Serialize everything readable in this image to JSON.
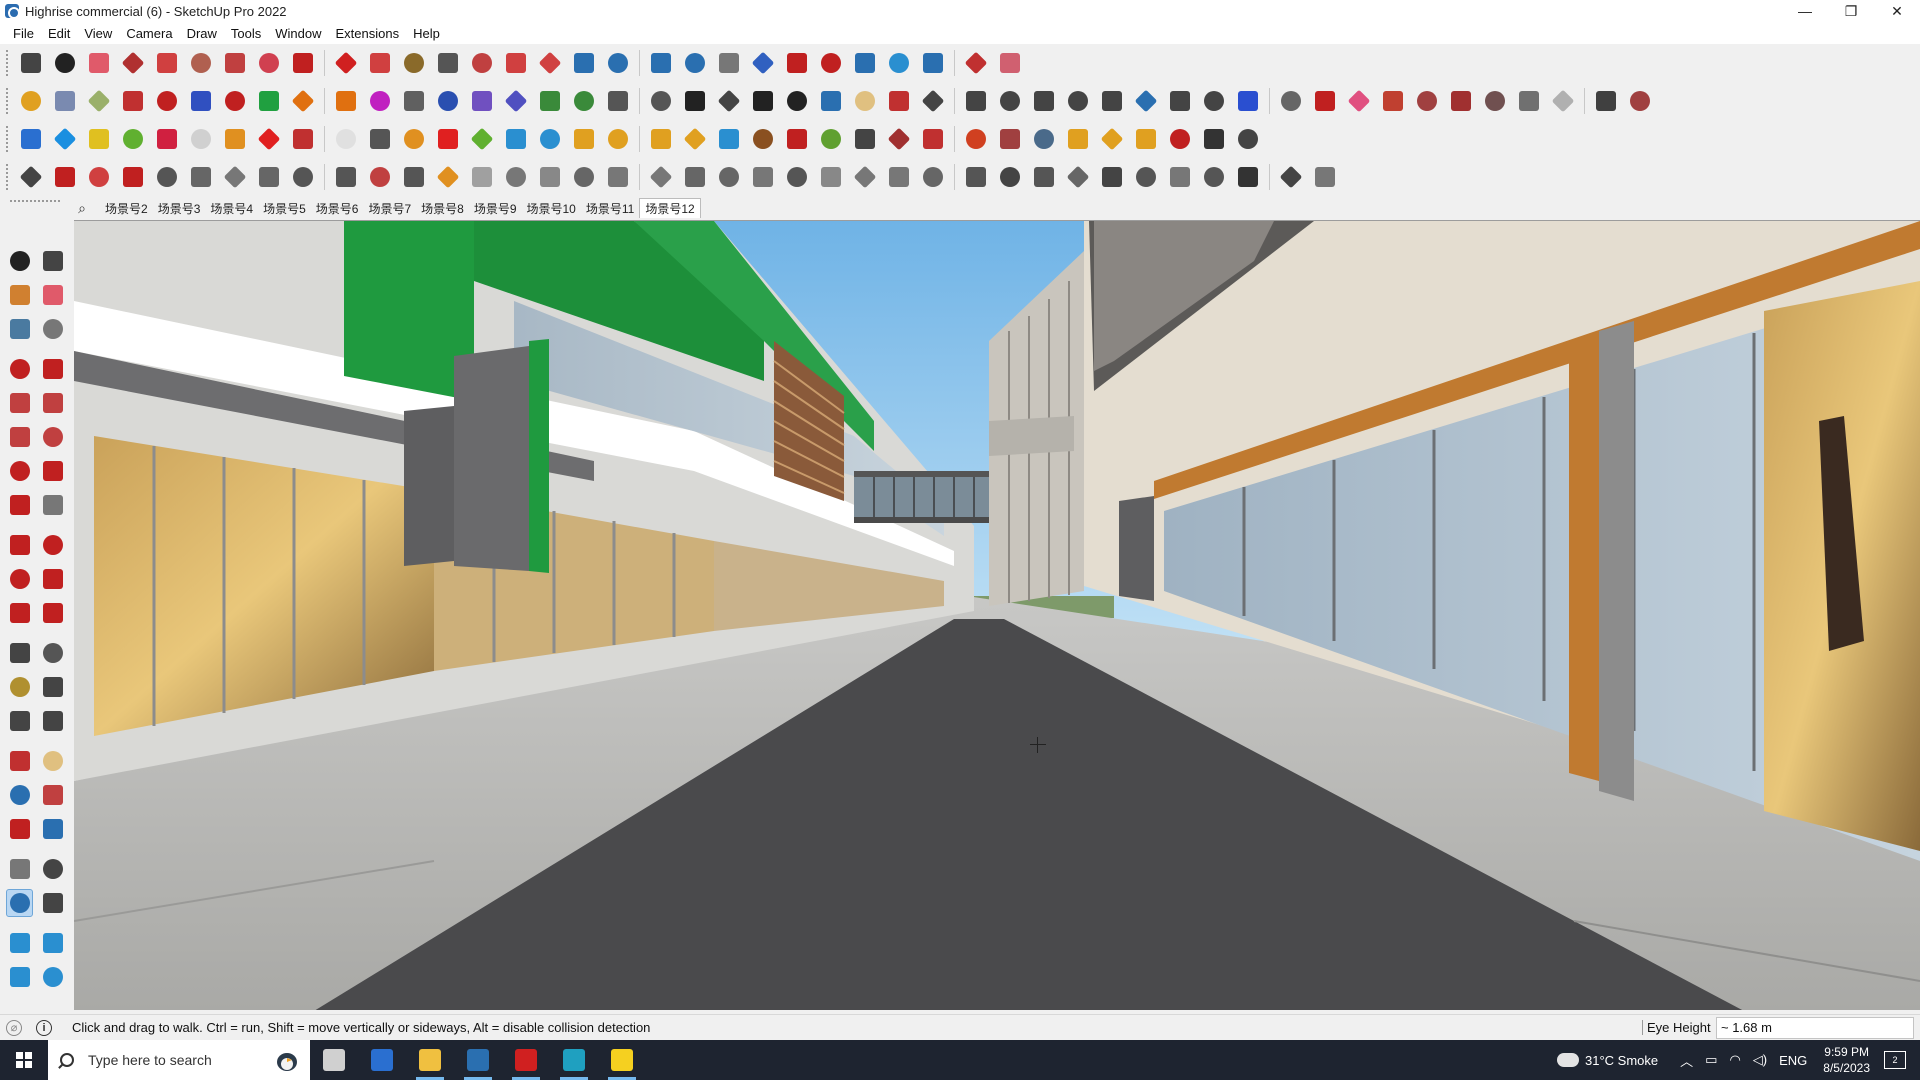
{
  "window": {
    "title": "Highrise commercial (6) - SketchUp Pro 2022",
    "minimize": "—",
    "maximize": "❐",
    "close": "✕"
  },
  "menu": [
    "File",
    "Edit",
    "View",
    "Camera",
    "Draw",
    "Tools",
    "Window",
    "Extensions",
    "Help"
  ],
  "toolbar_colors": {
    "row1": [
      "#444444",
      "#222222",
      "#e05a6a",
      "#b03030",
      "#d04040",
      "#b06050",
      "#c04040",
      "#d04050",
      "#c02020",
      "#d02020",
      "#d04040",
      "#8a6a2a",
      "#555555",
      "#c04040",
      "#d04040",
      "#d04040",
      "#2a6fb0",
      "#2a6fb0",
      "#2a6fb0",
      "#2a6fb0",
      "#777777",
      "#3060c0",
      "#c02020",
      "#c02020",
      "#2a6fb0",
      "#2a8fd0",
      "#2a6fb0",
      "#c03030",
      "#d06070"
    ],
    "row2": [
      "#e0a020",
      "#7a8ab0",
      "#9ab06a",
      "#c03030",
      "#c02020",
      "#3050c0",
      "#c02020",
      "#20a040",
      "#e07010",
      "#e07010",
      "#c020c0",
      "#606060",
      "#2a4fb0",
      "#7050c0",
      "#5050c0",
      "#3a8a3a",
      "#3a8a3a",
      "#555555",
      "#555555",
      "#222222",
      "#444444",
      "#222222",
      "#222222",
      "#2a6fb0",
      "#e0c080",
      "#c03030",
      "#444444",
      "#444444",
      "#444444",
      "#444444",
      "#444444",
      "#444444",
      "#2a6fb0",
      "#444444",
      "#444444",
      "#2a4fd0",
      "#666666",
      "#c02020",
      "#e05080",
      "#c04030",
      "#a04040",
      "#a03030",
      "#705050",
      "#707070",
      "#b0b0b0",
      "#404040",
      "#a04040"
    ],
    "row3": [
      "#2a6fd0",
      "#1a8fe0",
      "#e0c020",
      "#60b030",
      "#d02040",
      "#d0d0d0",
      "#e09020",
      "#e02020",
      "#c03030",
      "#e0e0e0",
      "#555555",
      "#e09020",
      "#e02020",
      "#60b030",
      "#2a8fd0",
      "#2a8fd0",
      "#e0a020",
      "#e0a020",
      "#e0a020",
      "#e0a020",
      "#2a8fd0",
      "#8a5020",
      "#c02020",
      "#60a030",
      "#444444",
      "#a03030",
      "#c03030",
      "#d04020",
      "#a04040",
      "#4a6a8a",
      "#e0a020",
      "#e0a020",
      "#e0a020",
      "#c02020",
      "#333333",
      "#444444"
    ],
    "row4": [
      "#444444",
      "#c02020",
      "#d04040",
      "#c02020",
      "#555555",
      "#666666",
      "#777777",
      "#666666",
      "#555555",
      "#555555",
      "#c04040",
      "#555555",
      "#e09020",
      "#a0a0a0",
      "#777777",
      "#888888",
      "#666666",
      "#777777",
      "#777777",
      "#666666",
      "#666666",
      "#777777",
      "#555555",
      "#888888",
      "#777777",
      "#777777",
      "#666666",
      "#555555",
      "#444444",
      "#555555",
      "#666666",
      "#444444",
      "#555555",
      "#777777",
      "#555555",
      "#333333",
      "#444444",
      "#777777"
    ]
  },
  "scenes": {
    "tabs": [
      "场景号2",
      "场景号3",
      "场景号4",
      "场景号5",
      "场景号6",
      "场景号7",
      "场景号8",
      "场景号9",
      "场景号10",
      "场景号11",
      "场景号12"
    ],
    "active_index": 10
  },
  "left_tools_colors": [
    [
      "#222222",
      "#444444"
    ],
    [
      "#d08030",
      "#e05a6a"
    ],
    [
      "#4a7aa0",
      "#777777"
    ],
    [
      "#c02020",
      "#c02020"
    ],
    [
      "#c04040",
      "#c04040"
    ],
    [
      "#c04040",
      "#c04040"
    ],
    [
      "#c02020",
      "#c02020"
    ],
    [
      "#c02020",
      "#777777"
    ],
    [
      "#c02020",
      "#c02020"
    ],
    [
      "#c02020",
      "#c02020"
    ],
    [
      "#c02020",
      "#c02020"
    ],
    [
      "#444444",
      "#555555"
    ],
    [
      "#b09030",
      "#444444"
    ],
    [
      "#444444",
      "#444444"
    ],
    [
      "#c03030",
      "#e0c080"
    ],
    [
      "#2a6fb0",
      "#c04040"
    ],
    [
      "#c02020",
      "#2a6fb0"
    ],
    [
      "#777777",
      "#444444"
    ],
    [
      "#2a6fb0",
      "#444444"
    ],
    [
      "#2a8fd0",
      "#2a8fd0"
    ],
    [
      "#2a8fd0",
      "#2a8fd0"
    ]
  ],
  "status": {
    "message": "Click and drag to walk.  Ctrl = run, Shift = move vertically or sideways, Alt = disable collision detection",
    "vcb_label": "Eye Height",
    "vcb_value": "~ 1.68 m"
  },
  "taskbar": {
    "search_placeholder": "Type here to search",
    "weather": "31°C  Smoke",
    "language": "ENG",
    "time": "9:59 PM",
    "date": "8/5/2023",
    "apps": [
      {
        "name": "task-view-icon",
        "color": "#d0d0d0"
      },
      {
        "name": "calculator-icon",
        "color": "#2a6fd0"
      },
      {
        "name": "file-explorer-icon",
        "color": "#f0c040"
      },
      {
        "name": "sketchup-icon",
        "color": "#2a6fb0"
      },
      {
        "name": "autocad-icon",
        "color": "#d02020"
      },
      {
        "name": "edge-icon",
        "color": "#1fa0c0"
      },
      {
        "name": "sticky-notes-icon",
        "color": "#f5d020"
      }
    ]
  }
}
